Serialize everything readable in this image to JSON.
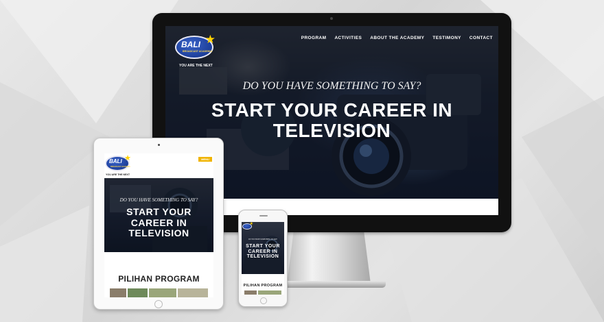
{
  "brand": {
    "name": "BALI",
    "subname": "BROADCAST ACADEMIA",
    "tagline": "YOU ARE THE NEXT"
  },
  "nav": {
    "items": [
      {
        "label": "PROGRAM"
      },
      {
        "label": "ACTIVITIES"
      },
      {
        "label": "ABOUT THE ACADEMY"
      },
      {
        "label": "TESTIMONY"
      },
      {
        "label": "CONTACT"
      }
    ]
  },
  "hero": {
    "subtitle": "DO YOU HAVE SOMETHING TO SAY?",
    "title_line1": "START YOUR CAREER IN",
    "title_line2": "TELEVISION"
  },
  "tablet": {
    "menu_label": "MENU",
    "hero_title_line1": "START YOUR",
    "hero_title_line2": "CAREER IN",
    "hero_title_line3": "TELEVISION",
    "section_title": "PILIHAN PROGRAM"
  },
  "phone": {
    "hero_title_line1": "START YOUR",
    "hero_title_line2": "CAREER IN",
    "hero_title_line3": "TELEVISION",
    "section_title": "PILIHAN PROGRAM"
  },
  "colors": {
    "accent": "#f0b400",
    "logo_blue": "#1d3f9a",
    "logo_star": "#ffd200",
    "hero_dark": "#10182a"
  },
  "icons": {
    "logo_star": "star-icon"
  }
}
